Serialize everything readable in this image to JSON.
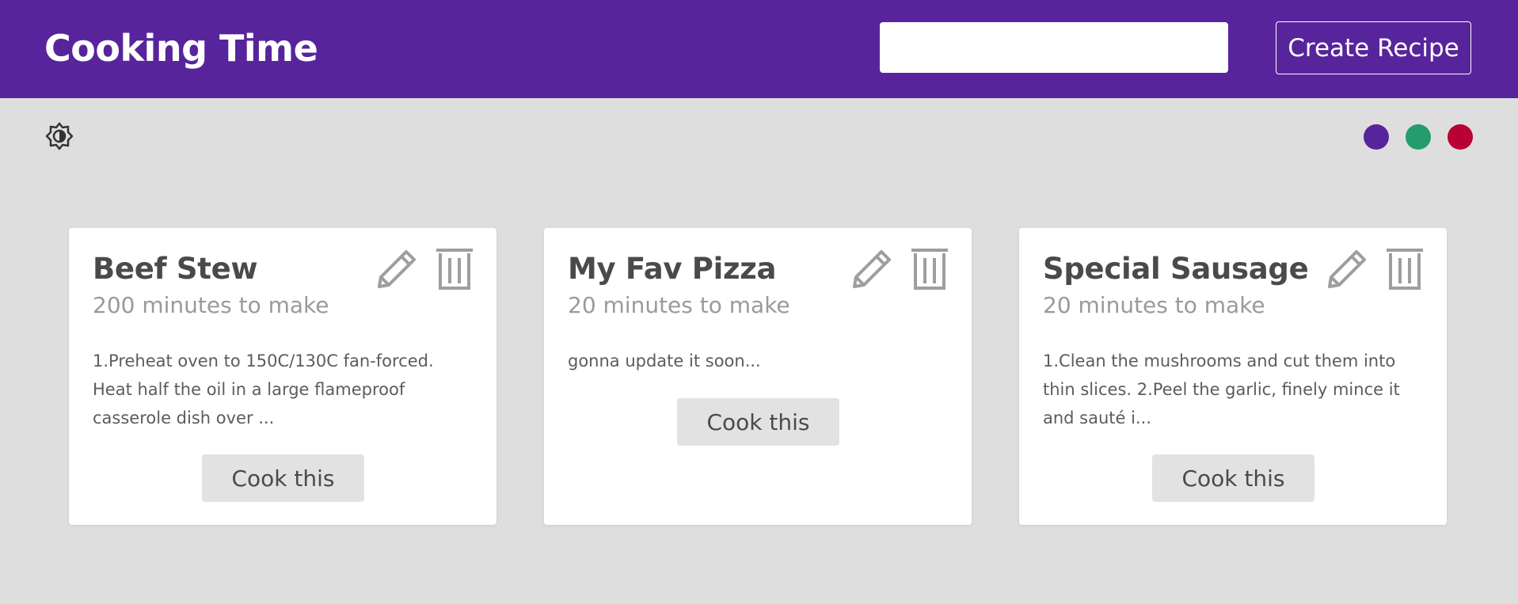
{
  "header": {
    "title": "Cooking Time",
    "search_placeholder": "",
    "search_value": "",
    "create_label": "Create Recipe"
  },
  "theme": {
    "mode_icon": "brightness-mode-icon",
    "colors": [
      "#58249c",
      "#249c6b",
      "#b70233"
    ],
    "accent": "#58249c"
  },
  "recipes": [
    {
      "title": "Beef Stew",
      "time": "200 minutes to make",
      "method": "1.Preheat oven to 150C/130C fan-forced. Heat half the oil in a large flameproof casserole dish over ...",
      "button": "Cook this"
    },
    {
      "title": "My Fav Pizza",
      "time": "20 minutes to make",
      "method": "gonna update it soon...",
      "button": "Cook this"
    },
    {
      "title": "Special Sausage",
      "time": "20 minutes to make",
      "method": "1.Clean the mushrooms and cut them into thin slices. 2.Peel the garlic, finely mince it and sauté i...",
      "button": "Cook this"
    }
  ],
  "icons": {
    "edit": "pencil-icon",
    "delete": "trash-icon"
  }
}
